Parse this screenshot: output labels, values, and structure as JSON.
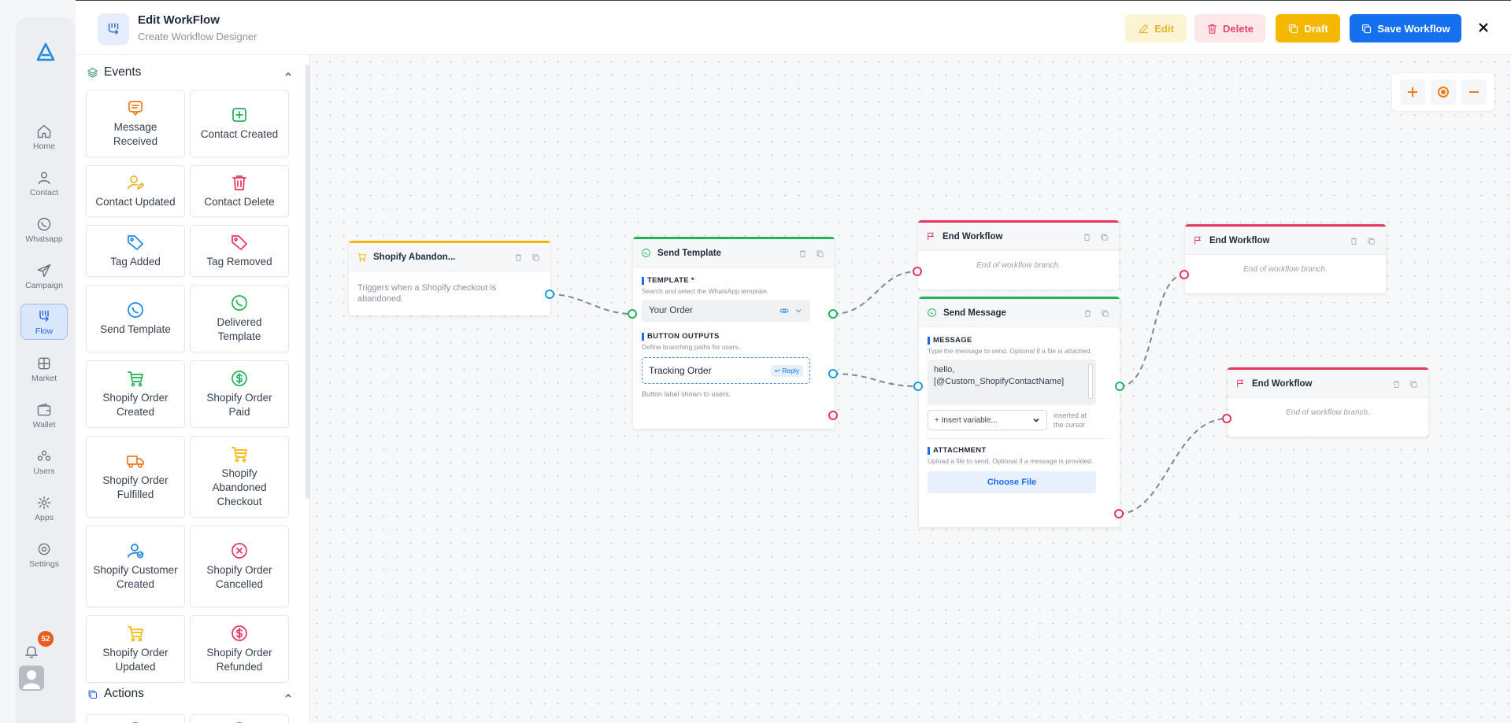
{
  "header": {
    "title": "Edit WorkFlow",
    "subtitle": "Create Workflow Designer",
    "edit_label": "Edit",
    "delete_label": "Delete",
    "draft_label": "Draft",
    "save_label": "Save Workflow"
  },
  "rail": {
    "items": [
      {
        "label": "Home",
        "icon": "home-icon"
      },
      {
        "label": "Contact",
        "icon": "user-icon"
      },
      {
        "label": "Whatsapp",
        "icon": "whatsapp-icon"
      },
      {
        "label": "Campaign",
        "icon": "send-icon"
      },
      {
        "label": "Flow",
        "icon": "flow-icon",
        "active": true
      },
      {
        "label": "Market",
        "icon": "grid-icon"
      },
      {
        "label": "Wallet",
        "icon": "wallet-icon"
      },
      {
        "label": "Users",
        "icon": "users-icon"
      },
      {
        "label": "Apps",
        "icon": "apps-icon"
      },
      {
        "label": "Settings",
        "icon": "settings-icon"
      }
    ],
    "notification_count": "52"
  },
  "sidebar": {
    "events_title": "Events",
    "actions_title": "Actions",
    "events": [
      {
        "label": "Message Received",
        "icon": "message-icon",
        "color": "#f07b1e"
      },
      {
        "label": "Contact Created",
        "icon": "plus-square-icon",
        "color": "#22b35a"
      },
      {
        "label": "Contact Updated",
        "icon": "user-edit-icon",
        "color": "#e3b52b"
      },
      {
        "label": "Contact Delete",
        "icon": "trash-icon",
        "color": "#e5365e"
      },
      {
        "label": "Tag Added",
        "icon": "tag-icon",
        "color": "#1e88e5"
      },
      {
        "label": "Tag Removed",
        "icon": "tag-icon",
        "color": "#e5365e"
      },
      {
        "label": "Send Template",
        "icon": "whatsapp-icon",
        "color": "#1e88e5"
      },
      {
        "label": "Delivered Template",
        "icon": "whatsapp-icon",
        "color": "#22b35a"
      },
      {
        "label": "Shopify Order Created",
        "icon": "cart-icon",
        "color": "#22b35a"
      },
      {
        "label": "Shopify Order Paid",
        "icon": "dollar-icon",
        "color": "#22b35a"
      },
      {
        "label": "Shopify Order Fulfilled",
        "icon": "truck-icon",
        "color": "#f07b1e"
      },
      {
        "label": "Shopify Abandoned Checkout",
        "icon": "cart-icon",
        "color": "#f5b800"
      },
      {
        "label": "Shopify Customer Created",
        "icon": "user-check-icon",
        "color": "#1e88e5"
      },
      {
        "label": "Shopify Order Cancelled",
        "icon": "x-circle-icon",
        "color": "#e5365e"
      },
      {
        "label": "Shopify Order Updated",
        "icon": "cart-icon",
        "color": "#f5b800"
      },
      {
        "label": "Shopify Order Refunded",
        "icon": "dollar-icon",
        "color": "#e5365e"
      }
    ]
  },
  "nodes": {
    "trigger": {
      "title": "Shopify Abandon...",
      "description": "Triggers when a Shopify checkout is abandoned."
    },
    "send_template": {
      "title": "Send Template",
      "template_label": "TEMPLATE *",
      "template_hint": "Search and select the WhatsApp template.",
      "template_value": "Your Order",
      "outputs_label": "BUTTON OUTPUTS",
      "outputs_hint": "Define branching paths for users.",
      "output_button": "Tracking Order",
      "reply_tag": "Reply",
      "outputs_footer": "Button label shown to users."
    },
    "end_1": {
      "title": "End Workflow",
      "message": "End of workflow branch."
    },
    "end_2": {
      "title": "End Workflow",
      "message": "End of workflow branch."
    },
    "end_3": {
      "title": "End Workflow",
      "message": "End of workflow branch."
    },
    "send_message": {
      "title": "Send Message",
      "message_label": "MESSAGE",
      "message_hint": "Type the message to send. Optional if a file is attached.",
      "message_line1": "hello,",
      "message_line2": "[@Custom_ShopifyContactName]",
      "insert_label": "+ Insert variable...",
      "insert_hint": "inserted at the cursor",
      "attachment_label": "ATTACHMENT",
      "attachment_hint": "Upload a file to send. Optional if a message is provided.",
      "choose_file": "Choose File"
    }
  },
  "colors": {
    "trigger_bar": "#f5b800",
    "template_bar": "#22b35a",
    "end_bar": "#e5365e",
    "message_bar": "#22b35a",
    "accent": "#1570ef"
  }
}
